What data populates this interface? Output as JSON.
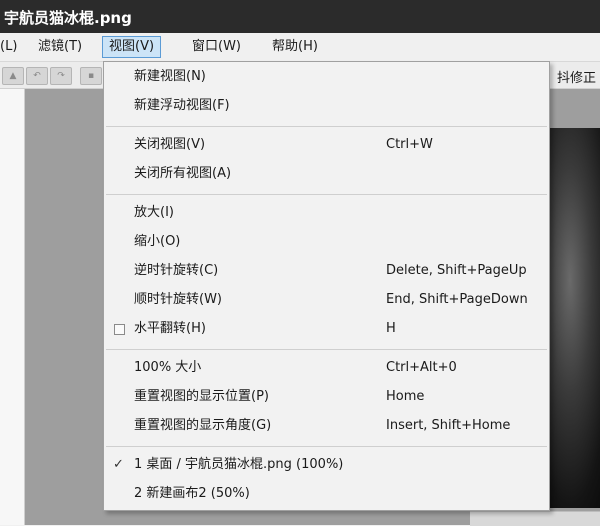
{
  "window": {
    "title": "宇航员猫冰棍.png"
  },
  "menubar": {
    "items": [
      {
        "label": "(L)"
      },
      {
        "label": "滤镜(T)"
      },
      {
        "label": "视图(V)"
      },
      {
        "label": "窗口(W)"
      },
      {
        "label": "帮助(H)"
      }
    ]
  },
  "toolbar": {
    "right_label": "抖修正"
  },
  "view_menu": {
    "new_view": "新建视图(N)",
    "new_float_view": "新建浮动视图(F)",
    "close_view": {
      "label": "关闭视图(V)",
      "shortcut": "Ctrl+W"
    },
    "close_all_views": "关闭所有视图(A)",
    "zoom_in": "放大(I)",
    "zoom_out": "缩小(O)",
    "rotate_ccw": {
      "label": "逆时针旋转(C)",
      "shortcut": "Delete, Shift+PageUp"
    },
    "rotate_cw": {
      "label": "顺时针旋转(W)",
      "shortcut": "End, Shift+PageDown"
    },
    "flip_horizontal": {
      "label": "水平翻转(H)",
      "shortcut": "H",
      "checked": false
    },
    "actual_size": {
      "label": "100% 大小",
      "shortcut": "Ctrl+Alt+0"
    },
    "reset_position": {
      "label": "重置视图的显示位置(P)",
      "shortcut": "Home"
    },
    "reset_angle": {
      "label": "重置视图的显示角度(G)",
      "shortcut": "Insert, Shift+Home"
    },
    "windows": [
      {
        "label": "1 桌面 / 宇航员猫冰棍.png (100%)",
        "checked": true
      },
      {
        "label": "2 新建画布2 (50%)",
        "checked": false
      }
    ]
  }
}
